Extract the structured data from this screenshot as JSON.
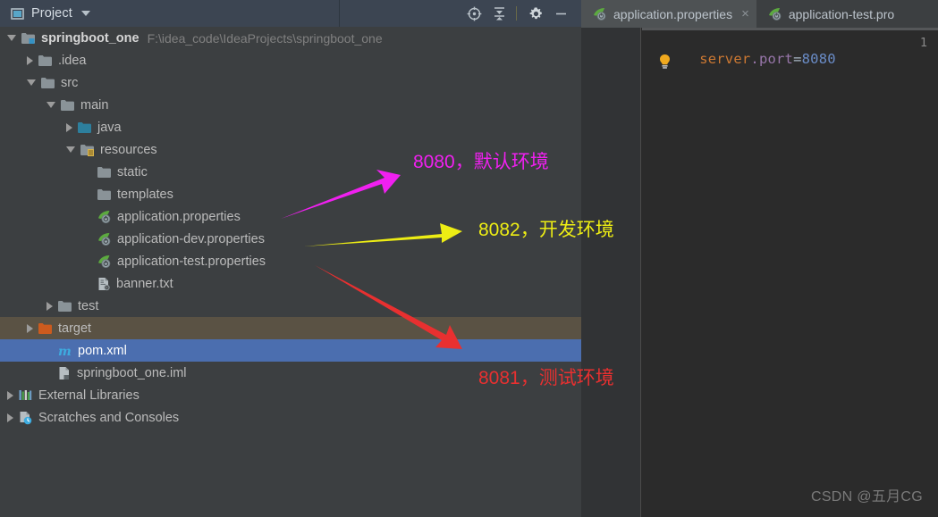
{
  "window": {
    "tool_window_title": "Project",
    "watermark": "CSDN @五月CG"
  },
  "toolbar": {
    "buttons": [
      {
        "name": "locate-icon",
        "tooltip": "Select Opened File"
      },
      {
        "name": "collapse-all-icon",
        "tooltip": "Collapse All"
      },
      {
        "name": "gear-icon",
        "tooltip": "Settings"
      },
      {
        "name": "minimize-icon",
        "tooltip": "Hide"
      }
    ]
  },
  "tabs": [
    {
      "label": "application.properties",
      "active": true,
      "close": "×"
    },
    {
      "label": "application-test.pro",
      "active": false,
      "close": ""
    }
  ],
  "tree": [
    {
      "label": "springboot_one",
      "path": "F:\\idea_code\\IdeaProjects\\springboot_one",
      "indent": 0,
      "arrow": "down",
      "icon": "module-folder-icon",
      "bold": true,
      "state": "normal"
    },
    {
      "label": ".idea",
      "path": "",
      "indent": 1,
      "arrow": "right",
      "icon": "folder-icon",
      "bold": false,
      "state": "normal"
    },
    {
      "label": "src",
      "path": "",
      "indent": 1,
      "arrow": "down",
      "icon": "folder-icon",
      "bold": false,
      "state": "normal"
    },
    {
      "label": "main",
      "path": "",
      "indent": 2,
      "arrow": "down",
      "icon": "folder-icon",
      "bold": false,
      "state": "normal"
    },
    {
      "label": "java",
      "path": "",
      "indent": 3,
      "arrow": "right",
      "icon": "source-folder-icon",
      "bold": false,
      "state": "normal"
    },
    {
      "label": "resources",
      "path": "",
      "indent": 3,
      "arrow": "down",
      "icon": "resources-folder-icon",
      "bold": false,
      "state": "normal"
    },
    {
      "label": "static",
      "path": "",
      "indent": 4,
      "arrow": "none",
      "icon": "folder-icon",
      "bold": false,
      "state": "normal"
    },
    {
      "label": "templates",
      "path": "",
      "indent": 4,
      "arrow": "none",
      "icon": "folder-icon",
      "bold": false,
      "state": "normal"
    },
    {
      "label": "application.properties",
      "path": "",
      "indent": 4,
      "arrow": "none",
      "icon": "spring-properties-icon",
      "bold": false,
      "state": "normal"
    },
    {
      "label": "application-dev.properties",
      "path": "",
      "indent": 4,
      "arrow": "none",
      "icon": "spring-properties-icon",
      "bold": false,
      "state": "normal"
    },
    {
      "label": "application-test.properties",
      "path": "",
      "indent": 4,
      "arrow": "none",
      "icon": "spring-properties-icon",
      "bold": false,
      "state": "normal"
    },
    {
      "label": "banner.txt",
      "path": "",
      "indent": 4,
      "arrow": "none",
      "icon": "text-file-icon",
      "bold": false,
      "state": "normal"
    },
    {
      "label": "test",
      "path": "",
      "indent": 2,
      "arrow": "right",
      "icon": "folder-icon",
      "bold": false,
      "state": "normal"
    },
    {
      "label": "target",
      "path": "",
      "indent": 1,
      "arrow": "right",
      "icon": "excluded-folder-icon",
      "bold": false,
      "state": "hover"
    },
    {
      "label": "pom.xml",
      "path": "",
      "indent": 2,
      "arrow": "none",
      "icon": "maven-icon",
      "bold": false,
      "state": "selected"
    },
    {
      "label": "springboot_one.iml",
      "path": "",
      "indent": 2,
      "arrow": "none",
      "icon": "iml-file-icon",
      "bold": false,
      "state": "normal"
    },
    {
      "label": "External Libraries",
      "path": "",
      "indent": 0,
      "arrow": "right",
      "icon": "libraries-icon",
      "bold": false,
      "state": "normal"
    },
    {
      "label": "Scratches and Consoles",
      "path": "",
      "indent": 0,
      "arrow": "right",
      "icon": "scratches-icon",
      "bold": false,
      "state": "normal"
    }
  ],
  "editor": {
    "line_number": "1",
    "code": {
      "key_first": "server",
      "dot": ".",
      "key_second": "port",
      "equals": "=",
      "value": "8080"
    },
    "intention_bulb": "lightbulb-icon"
  },
  "annotations": [
    {
      "id": "default",
      "text": "8080，默认环境",
      "color": "#f020f0"
    },
    {
      "id": "dev",
      "text": "8082，开发环境",
      "color": "#eded14"
    },
    {
      "id": "test",
      "text": "8081，测试环境",
      "color": "#e83030"
    }
  ],
  "colors": {
    "panel_bg": "#3c3f41",
    "editor_bg": "#2b2b2b",
    "header_bg": "#3c4552",
    "selection_blue": "#4b6eaf",
    "hover_olive": "#5a5244",
    "magenta": "#f020f0",
    "yellow": "#eded14",
    "red": "#e83030"
  }
}
